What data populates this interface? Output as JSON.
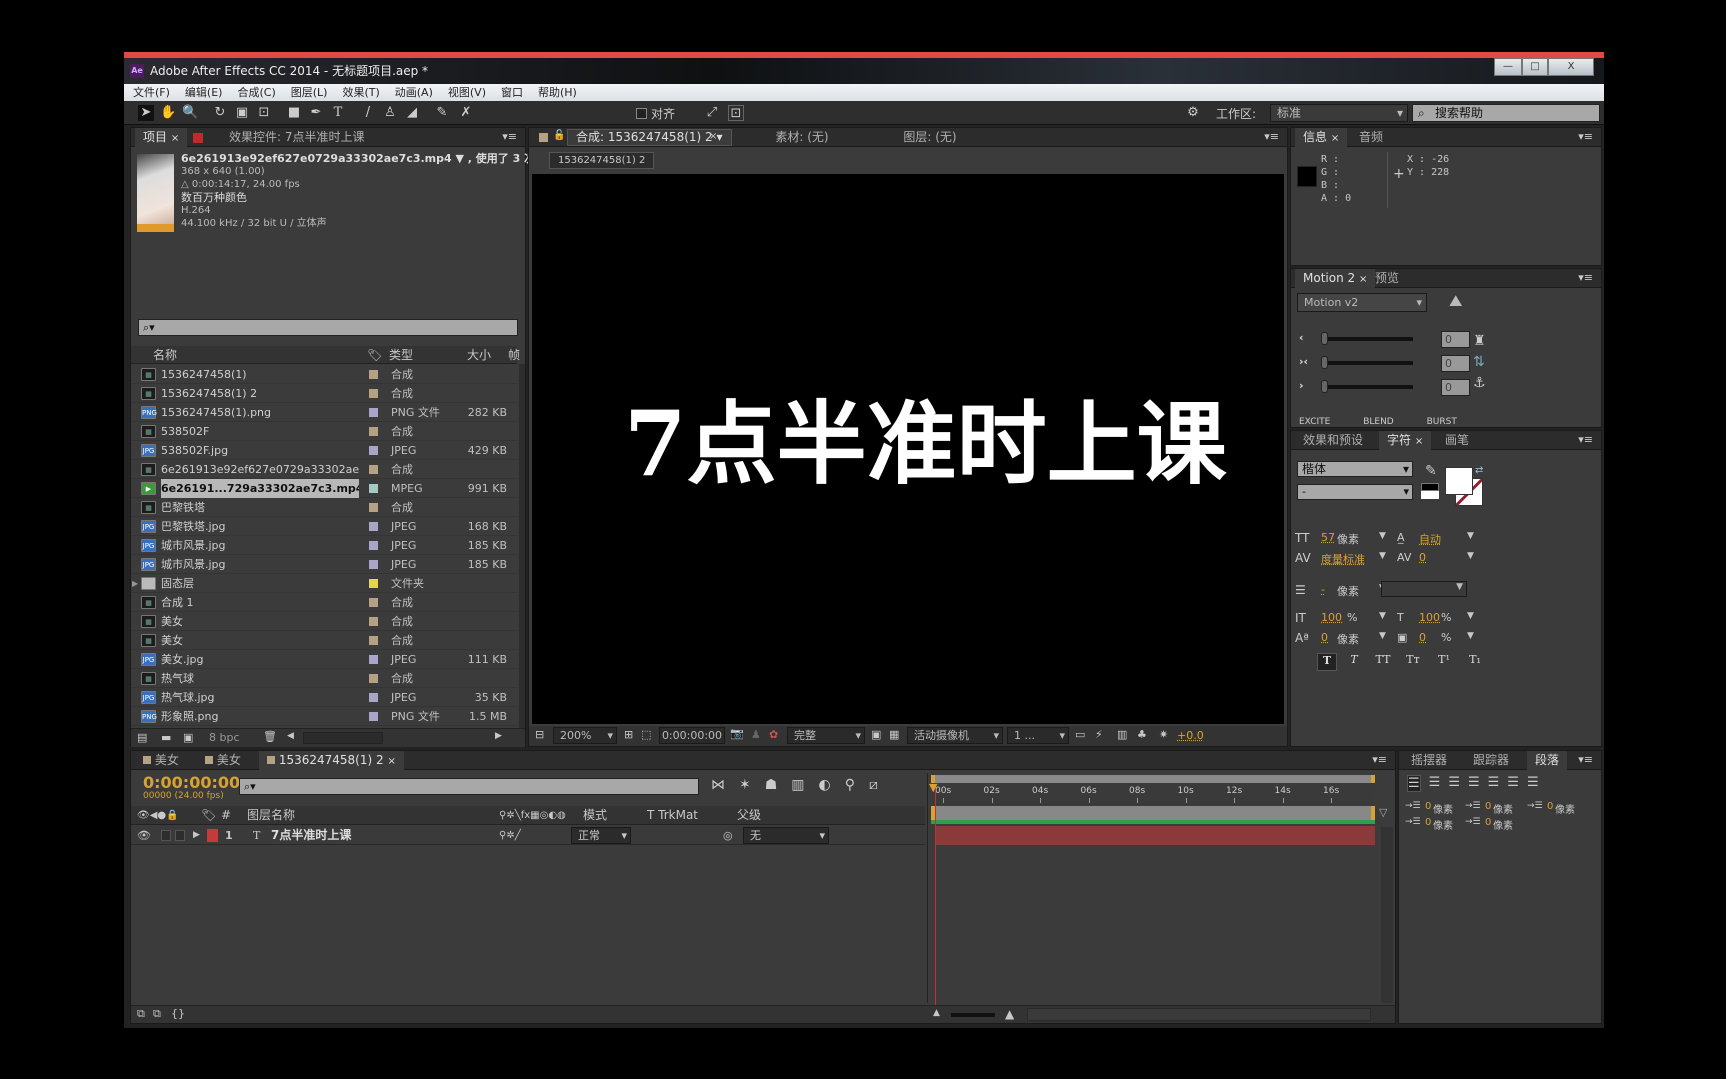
{
  "window": {
    "title": "Adobe After Effects CC 2014 - 无标题项目.aep *",
    "logo": "Ae",
    "controls": [
      "—",
      "□",
      "X"
    ]
  },
  "menu": [
    "文件(F)",
    "编辑(E)",
    "合成(C)",
    "图层(L)",
    "效果(T)",
    "动画(A)",
    "视图(V)",
    "窗口",
    "帮助(H)"
  ],
  "toolbar": {
    "snap_label": "对齐",
    "workspace_label": "工作区:",
    "workspace_value": "标准",
    "search_placeholder": "搜索帮助"
  },
  "project": {
    "tabs": [
      "项目",
      "效果控件: 7点半准时上课"
    ],
    "info": {
      "filename": "6e261913e92ef627e0729a33302ae7c3.mp4 ▼ , 使用了 3 次",
      "dims": "368 x 640 (1.00)",
      "duration": "△ 0:00:14:17, 24.00 fps",
      "colors": "数百万种颜色",
      "codec": "H.264",
      "audio": "44.100 kHz / 32 bit U / 立体声"
    },
    "columns": [
      "名称",
      "类型",
      "大小",
      "帧"
    ],
    "items": [
      {
        "name": "1536247458(1)",
        "type": "合成",
        "size": "",
        "icon": "comp",
        "label": "#b5a284"
      },
      {
        "name": "1536247458(1) 2",
        "type": "合成",
        "size": "",
        "icon": "comp",
        "label": "#b5a284"
      },
      {
        "name": "1536247458(1).png",
        "type": "PNG 文件",
        "size": "282 KB",
        "icon": "png",
        "label": "#a9a5c8"
      },
      {
        "name": "538502F",
        "type": "合成",
        "size": "",
        "icon": "comp",
        "label": "#b5a284"
      },
      {
        "name": "538502F.jpg",
        "type": "JPEG",
        "size": "429 KB",
        "icon": "jpg",
        "label": "#a9a5c8"
      },
      {
        "name": "6e261913e92ef627e0729a33302ae7c3",
        "type": "合成",
        "size": "",
        "icon": "comp",
        "label": "#b5a284"
      },
      {
        "name": "6e26191...729a33302ae7c3.mp4",
        "type": "MPEG",
        "size": "991 KB",
        "icon": "mpeg",
        "label": "#a6c9c2",
        "selected": true
      },
      {
        "name": "巴黎铁塔",
        "type": "合成",
        "size": "",
        "icon": "comp",
        "label": "#b5a284"
      },
      {
        "name": "巴黎铁塔.jpg",
        "type": "JPEG",
        "size": "168 KB",
        "icon": "jpg",
        "label": "#a9a5c8"
      },
      {
        "name": "城市风景.jpg",
        "type": "JPEG",
        "size": "185 KB",
        "icon": "jpg",
        "label": "#a9a5c8"
      },
      {
        "name": "城市风景.jpg",
        "type": "JPEG",
        "size": "185 KB",
        "icon": "jpg",
        "label": "#a9a5c8"
      },
      {
        "name": "固态层",
        "type": "文件夹",
        "size": "",
        "icon": "folder",
        "label": "#e3d84a"
      },
      {
        "name": "合成 1",
        "type": "合成",
        "size": "",
        "icon": "comp",
        "label": "#b5a284"
      },
      {
        "name": "美女",
        "type": "合成",
        "size": "",
        "icon": "comp",
        "label": "#b5a284"
      },
      {
        "name": "美女",
        "type": "合成",
        "size": "",
        "icon": "comp",
        "label": "#b5a284"
      },
      {
        "name": "美女.jpg",
        "type": "JPEG",
        "size": "111 KB",
        "icon": "jpg",
        "label": "#a9a5c8"
      },
      {
        "name": "热气球",
        "type": "合成",
        "size": "",
        "icon": "comp",
        "label": "#b5a284"
      },
      {
        "name": "热气球.jpg",
        "type": "JPEG",
        "size": "35 KB",
        "icon": "jpg",
        "label": "#a9a5c8"
      },
      {
        "name": "形象照.png",
        "type": "PNG 文件",
        "size": "1.5 MB",
        "icon": "png",
        "label": "#a9a5c8"
      }
    ],
    "bpc": "8 bpc"
  },
  "viewer": {
    "tabs": [
      "合成: 1536247458(1) 2",
      "素材: (无)",
      "图层: (无)"
    ],
    "subtab": "1536247458(1) 2",
    "text": "7点半准时上课",
    "bottom": {
      "zoom": "200%",
      "timecode": "0:00:00:00",
      "resolution": "完整",
      "camera": "活动摄像机",
      "views": "1 ...",
      "exposure": "+0.0"
    }
  },
  "info": {
    "tabs": [
      "信息",
      "音频"
    ],
    "r": "R :",
    "g": "G :",
    "b": "B :",
    "a": "A : 0",
    "x": "X : -26",
    "y": "Y : 228"
  },
  "motion": {
    "tabs": [
      "Motion 2",
      "预览"
    ],
    "preset": "Motion v2",
    "values": [
      "0",
      "0",
      "0"
    ],
    "buttons": [
      "EXCITE",
      "BLEND",
      "BURST"
    ]
  },
  "character": {
    "tabs": [
      "效果和预设",
      "字符",
      "画笔"
    ],
    "font": "楷体",
    "style": "-",
    "size": "57",
    "size_unit": "像素",
    "leading": "自动",
    "kerning": "度量标准",
    "tracking": "0",
    "stroke": "-",
    "stroke_unit": "像素",
    "vscale": "100",
    "hscale": "100",
    "pct": "%",
    "baseline": "0",
    "baseline_unit": "像素",
    "tsume": "0",
    "tsume_unit": "%",
    "styles": [
      "T",
      "T",
      "TT",
      "Tт",
      "T¹",
      "T₁"
    ]
  },
  "timeline": {
    "tabs": [
      "美女",
      "美女",
      "1536247458(1) 2"
    ],
    "timecode": "0:00:00:00",
    "frames": "00000 (24.00 fps)",
    "columns": {
      "name": "图层名称",
      "num": "#",
      "mode": "模式",
      "trkmat": "T  TrkMat",
      "parent": "父级"
    },
    "ruler": [
      "00s",
      "02s",
      "04s",
      "06s",
      "08s",
      "10s",
      "12s",
      "14s",
      "16s"
    ],
    "layer": {
      "index": "1",
      "name": "7点半准时上课",
      "mode": "正常",
      "parent": "无",
      "color": "#c83a3a"
    }
  },
  "paragraph": {
    "tabs": [
      "摇摆器",
      "跟踪器",
      "段落"
    ],
    "indents": [
      {
        "v": "0",
        "u": "像素"
      },
      {
        "v": "0",
        "u": "像素"
      },
      {
        "v": "0",
        "u": "像素"
      },
      {
        "v": "0",
        "u": "像素"
      },
      {
        "v": "0",
        "u": "像素"
      }
    ]
  }
}
